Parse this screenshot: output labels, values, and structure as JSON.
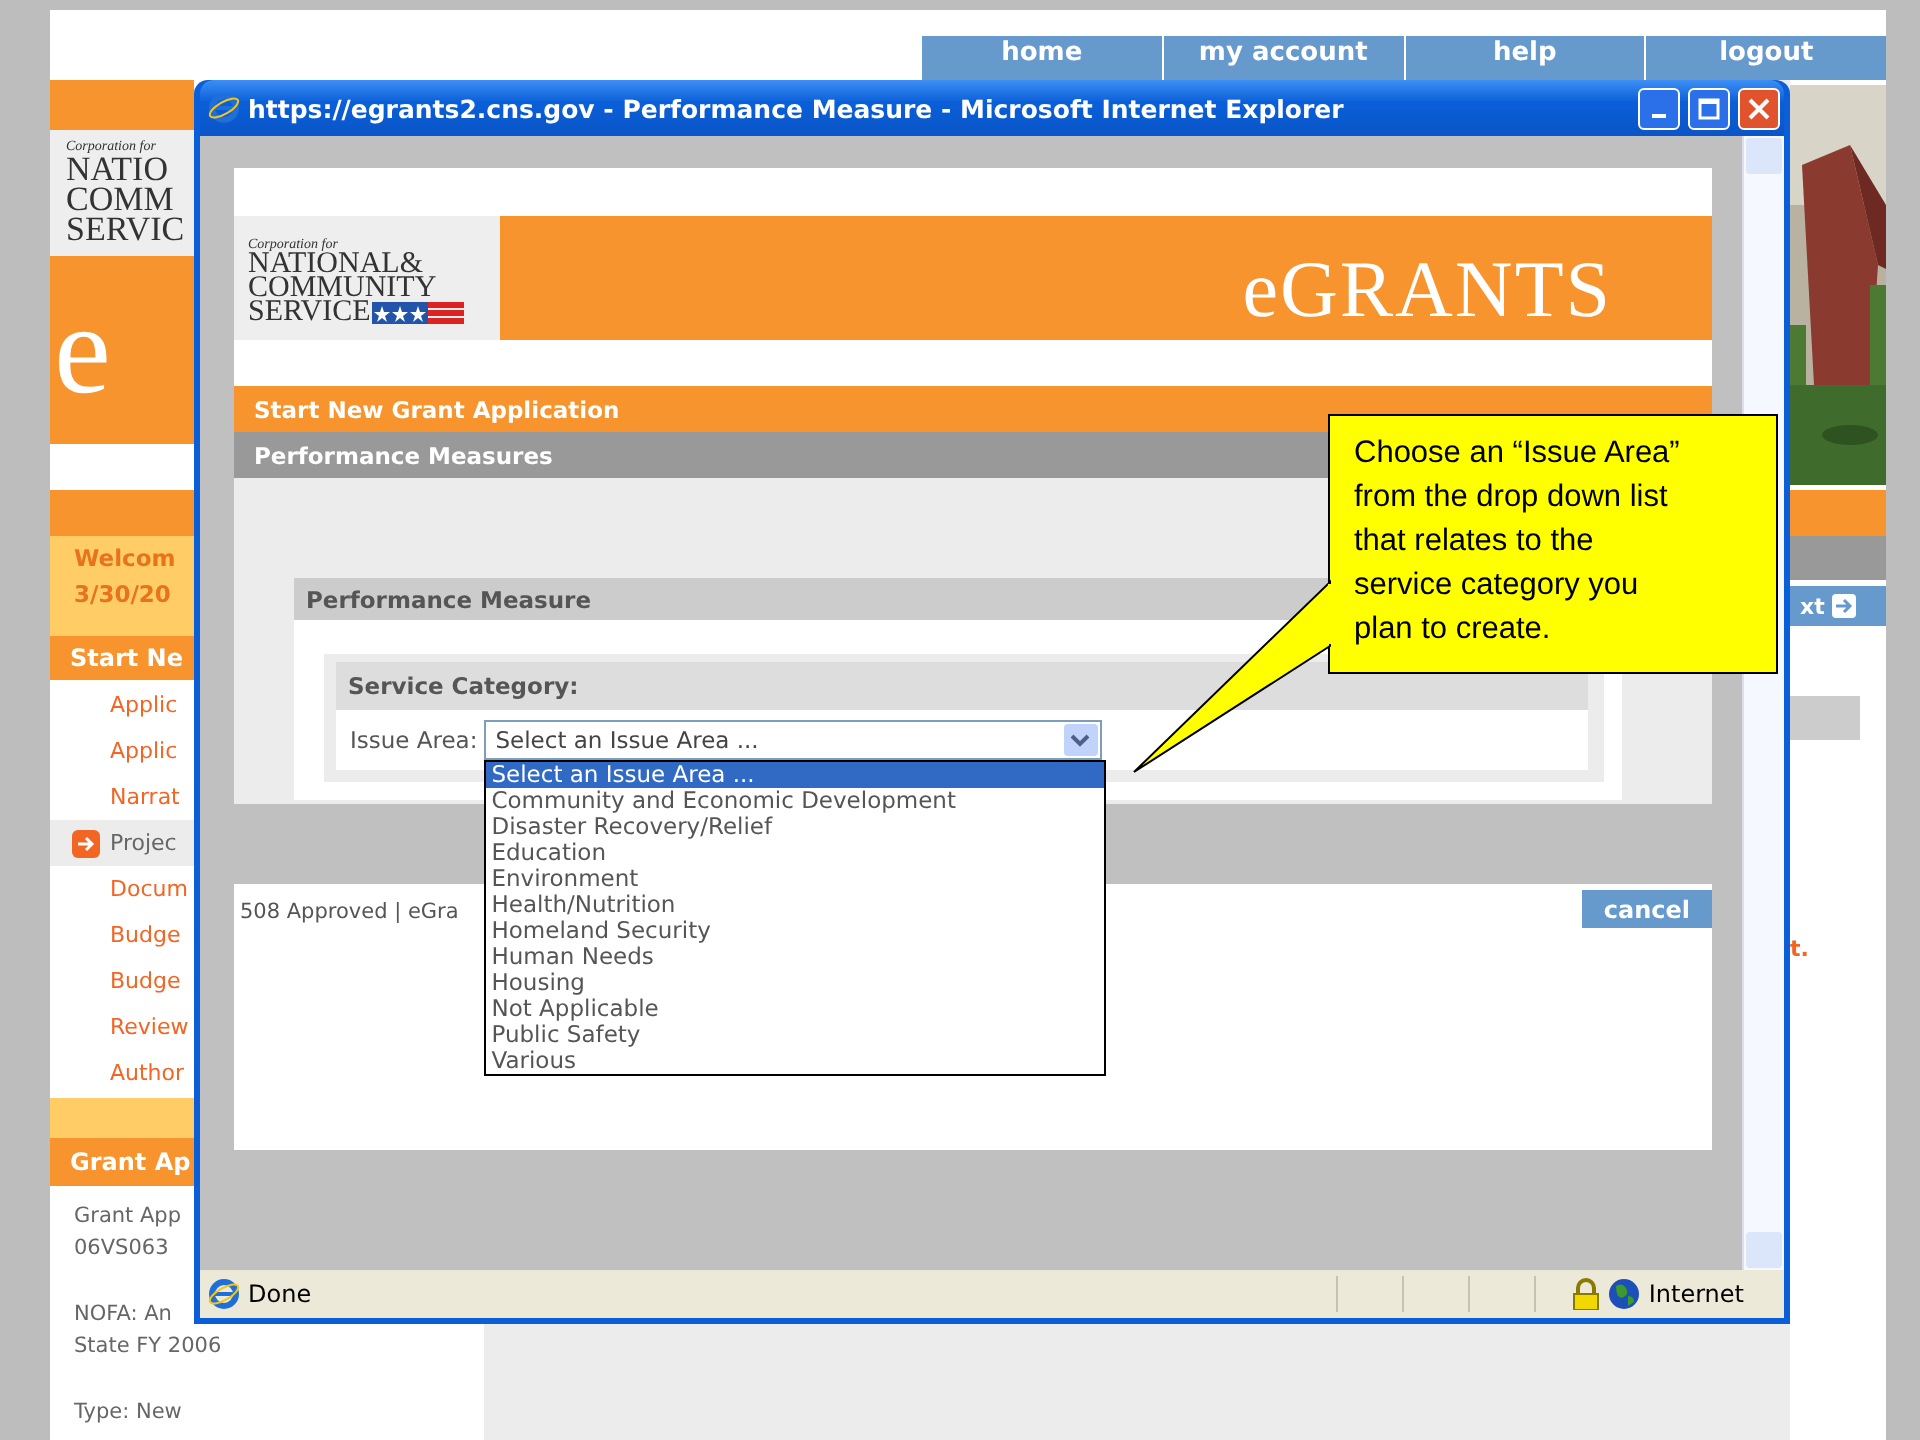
{
  "background_page": {
    "nav_tabs": [
      "home",
      "my account",
      "help",
      "logout"
    ],
    "logo": {
      "small": "Corporation for",
      "lines": [
        "NATIO",
        "COMM",
        "SERVIC"
      ]
    },
    "banner_text": "e",
    "welcome": "Welcom",
    "date": "3/30/20",
    "section_title": "Start Ne",
    "menu": [
      {
        "label": "Applic",
        "selected": false
      },
      {
        "label": "Applic",
        "selected": false
      },
      {
        "label": "Narrat",
        "selected": false
      },
      {
        "label": "Projec",
        "selected": true
      },
      {
        "label": "Docum",
        "selected": false
      },
      {
        "label": "Budge",
        "selected": false
      },
      {
        "label": "Budge",
        "selected": false
      },
      {
        "label": "Review",
        "selected": false
      },
      {
        "label": "Author",
        "selected": false
      }
    ],
    "info_title": "Grant Ap",
    "info_groups": [
      [
        "Grant App",
        "06VS063"
      ],
      [
        "NOFA: An",
        "State FY 2006"
      ],
      [
        "Type: New"
      ]
    ],
    "next_link": "xt",
    "note_fragment": "t."
  },
  "popup": {
    "title": "https://egrants2.cns.gov - Performance Measure - Microsoft Internet Explorer",
    "logo": {
      "small": "Corporation for",
      "lines": [
        "NATIONAL&",
        "COMMUNITY",
        "SERVICE"
      ]
    },
    "banner_text": "eGRANTS",
    "breadcrumb": "Start New Grant Application",
    "page_title": "Performance Measures",
    "panel_title": "Performance Measure",
    "section_title": "Service Category:",
    "field_label": "Issue Area:",
    "select_value": "Select an Issue Area ...",
    "options": [
      {
        "label": "Select an Issue Area ...",
        "selected": true
      },
      {
        "label": "Community and Economic Development",
        "selected": false
      },
      {
        "label": "Disaster Recovery/Relief",
        "selected": false
      },
      {
        "label": "Education",
        "selected": false
      },
      {
        "label": "Environment",
        "selected": false
      },
      {
        "label": "Health/Nutrition",
        "selected": false
      },
      {
        "label": "Homeland Security",
        "selected": false
      },
      {
        "label": "Human Needs",
        "selected": false
      },
      {
        "label": "Housing",
        "selected": false
      },
      {
        "label": "Not Applicable",
        "selected": false
      },
      {
        "label": "Public Safety",
        "selected": false
      },
      {
        "label": "Various",
        "selected": false
      }
    ],
    "footer_text": "508 Approved | eGra",
    "cancel_button": "cancel",
    "status": "Done",
    "zone": "Internet"
  },
  "callout": "Choose an “Issue Area” from the drop down list that relates to the service category you plan to create."
}
